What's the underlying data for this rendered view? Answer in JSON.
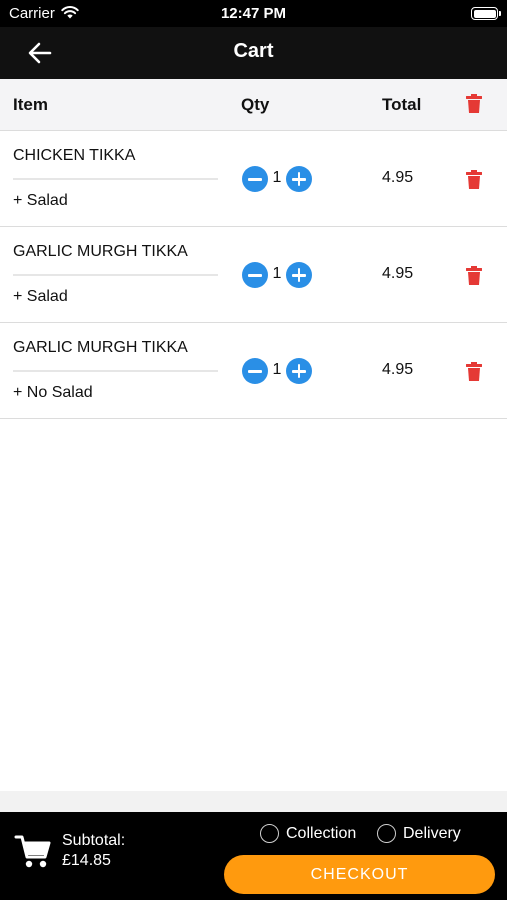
{
  "status_bar": {
    "carrier": "Carrier",
    "time": "12:47 PM"
  },
  "nav": {
    "title": "Cart",
    "back_icon": "arrow-left-icon"
  },
  "table_header": {
    "item": "Item",
    "qty": "Qty",
    "total": "Total",
    "delete_all_icon": "trash-icon"
  },
  "items": [
    {
      "name": "CHICKEN TIKKA",
      "option": "+ Salad",
      "qty": "1",
      "total": "4.95"
    },
    {
      "name": "GARLIC MURGH TIKKA",
      "option": "+ Salad",
      "qty": "1",
      "total": "4.95"
    },
    {
      "name": "GARLIC MURGH TIKKA",
      "option": "+ No Salad",
      "qty": "1",
      "total": "4.95"
    }
  ],
  "footer": {
    "subtotal_label": "Subtotal:",
    "subtotal_value": "£14.85",
    "collection_label": "Collection",
    "delivery_label": "Delivery",
    "checkout_label": "CHECKOUT",
    "cart_icon": "shopping-cart-icon"
  },
  "colors": {
    "accent_blue": "#2a8fe6",
    "delete_red": "#e53935",
    "checkout_orange": "#ff9a0e",
    "bar_black": "#111111"
  }
}
